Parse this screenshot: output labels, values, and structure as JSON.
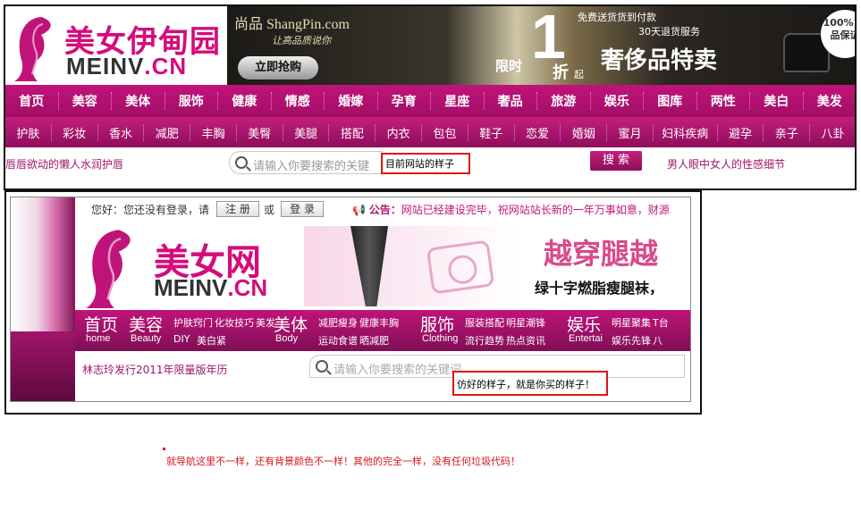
{
  "top": {
    "logo_cn": "美女伊甸园",
    "logo_en_a": "MEINV",
    "logo_en_b": ".CN",
    "banner": {
      "brand": "尚品 ShangPin.com",
      "brand_sub": "让高品质说你",
      "buy_button": "立即抢购",
      "free_ship": "免费送货货到付款",
      "returns": "30天退货服务",
      "big_number": "1",
      "limit": "限时",
      "zhe": "折",
      "qi": "起",
      "luxury": "奢侈品特卖",
      "badge": "100% 正品保证"
    },
    "nav_main": [
      "首页",
      "美容",
      "美体",
      "服饰",
      "健康",
      "情感",
      "婚嫁",
      "孕育",
      "星座",
      "奢品",
      "旅游",
      "娱乐",
      "图库",
      "两性",
      "美白",
      "美发"
    ],
    "nav_sub": [
      "护肤",
      "彩妆",
      "香水",
      "减肥",
      "丰胸",
      "美臀",
      "美腿",
      "搭配",
      "内衣",
      "包包",
      "鞋子",
      "恋爱",
      "婚姻",
      "蜜月",
      "妇科疾病",
      "避孕",
      "亲子",
      "八卦"
    ],
    "search": {
      "left_text": "唇唇欲动的懒人水润护唇",
      "placeholder": "请输入你要搜索的关键",
      "button": "搜 索",
      "right_text": "男人眼中女人的性感细节"
    },
    "note": "目前网站的样子"
  },
  "bottom": {
    "welcome": "您好：您还没有登录，请",
    "register": "注 册",
    "or": "或",
    "login": "登 录",
    "notice_label": "公告：",
    "notice_text": "网站已经建设完毕，祝网站站长新的一年万事如意，财源",
    "logo_cn": "美女网",
    "logo_en_a": "MEINV",
    "logo_en_b": ".CN",
    "banner_t1": "越穿腿越",
    "banner_t2": "绿十字燃脂瘦腿袜，",
    "nav": [
      {
        "cn": "首页",
        "en": "home"
      },
      {
        "cn": "美容",
        "en": "Beauty",
        "subs": [
          "护肤窍门",
          "化妆技巧",
          "美发",
          "DIY",
          "美白紧"
        ]
      },
      {
        "cn": "美体",
        "en": "Body",
        "subs": [
          "减肥瘦身",
          "健康丰胸",
          "运动食谱",
          "晒减肥"
        ]
      },
      {
        "cn": "服饰",
        "en": "Clothing",
        "subs": [
          "服装搭配",
          "明星潮锋",
          "流行趋势",
          "热点资讯"
        ]
      },
      {
        "cn": "娱乐",
        "en": "Entertai",
        "subs": [
          "明星聚集",
          "T台",
          "娱乐先锋",
          "八"
        ]
      }
    ],
    "promo": "林志玲发行2011年限量版年历",
    "search_placeholder": "请输入你要搜索的关键词...",
    "note": "仿好的样子，就是你买的样子！"
  },
  "footer_note": "就导航这里不一样，还有背景颜色不一样！其他的完全一样，没有任何垃圾代码！",
  "colors": {
    "accent": "#c1137a",
    "note_border": "#e01414"
  }
}
